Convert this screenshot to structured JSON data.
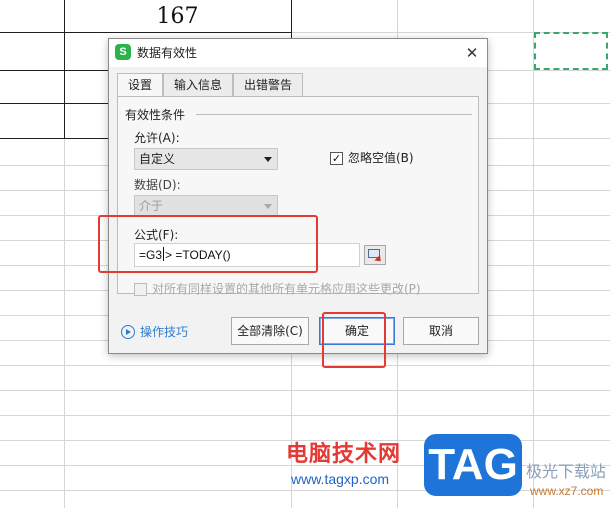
{
  "sheet": {
    "cell_value": "167"
  },
  "dialog": {
    "app_icon": "S",
    "title": "数据有效性",
    "close": "✕",
    "tabs": [
      {
        "label": "设置",
        "active": true
      },
      {
        "label": "输入信息",
        "active": false
      },
      {
        "label": "出错警告",
        "active": false
      }
    ],
    "group_label": "有效性条件",
    "allow": {
      "label": "允许(A):",
      "value": "自定义"
    },
    "ignore_blank": {
      "label": "忽略空值(B)",
      "checked": true,
      "mark": "✓"
    },
    "data": {
      "label": "数据(D):",
      "value": "介于",
      "disabled": true
    },
    "formula": {
      "label": "公式(F):",
      "value_before_caret": "=G3",
      "value_after_caret": "> =TODAY()"
    },
    "apply_all": {
      "label": "对所有同样设置的其他所有单元格应用这些更改(P)",
      "checked": false,
      "disabled": true
    },
    "tips_label": "操作技巧",
    "buttons": {
      "clear_all": "全部清除(C)",
      "ok": "确定",
      "cancel": "取消"
    }
  },
  "watermark": {
    "site_name": "电脑技术网",
    "site_url": "www.tagxp.com",
    "tag_logo": "TAG",
    "xz_name": "极光下载站",
    "xz_url": "www.xz7.com"
  },
  "colors": {
    "accent": "#2b7cd3",
    "annotation_red": "#e53935",
    "selection_green": "#3aa76d",
    "app_icon_green": "#2bb24c"
  }
}
